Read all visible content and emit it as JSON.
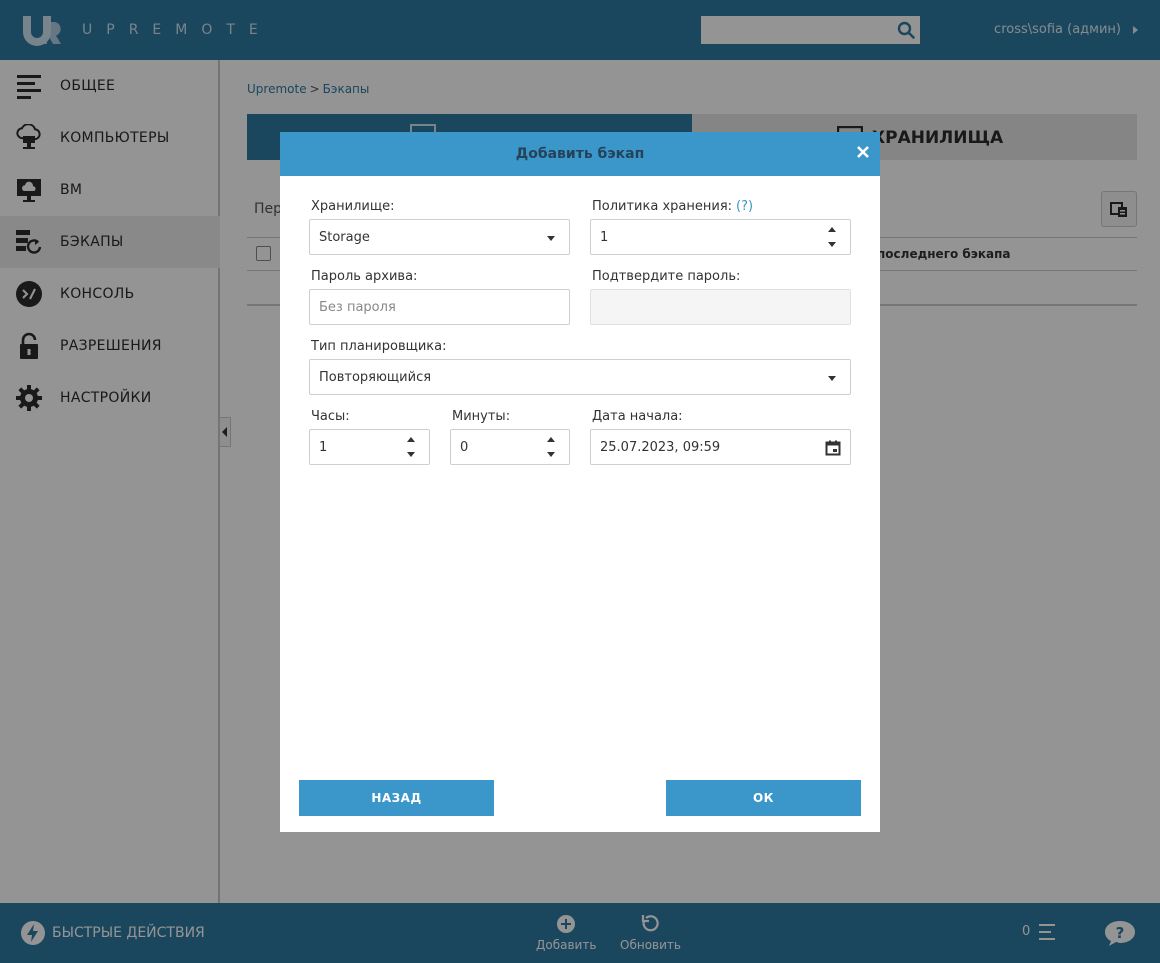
{
  "header": {
    "logo_text": "UPREMOTE",
    "search_value": "",
    "user": "cross\\sofia (админ)"
  },
  "sidebar": {
    "items": [
      {
        "label": "ОБЩЕЕ",
        "icon": "list-icon",
        "active": false
      },
      {
        "label": "КОМПЬЮТЕРЫ",
        "icon": "computers-icon",
        "active": false
      },
      {
        "label": "ВМ",
        "icon": "vm-icon",
        "active": false
      },
      {
        "label": "БЭКАПЫ",
        "icon": "backups-icon",
        "active": true
      },
      {
        "label": "КОНСОЛЬ",
        "icon": "console-icon",
        "active": false
      },
      {
        "label": "РАЗРЕШЕНИЯ",
        "icon": "lock-icon",
        "active": false
      },
      {
        "label": "НАСТРОЙКИ",
        "icon": "gear-icon",
        "active": false
      }
    ]
  },
  "main": {
    "breadcrumb": {
      "root": "Upremote",
      "separator": ">",
      "current": "Бэкапы"
    },
    "tabs": {
      "right_label": "ХРАНИЛИЩА"
    },
    "toolbar_text": "Пер",
    "table": {
      "last_column": "последнего бэкапа"
    }
  },
  "modal": {
    "title": "Добавить бэкап",
    "storage": {
      "label": "Хранилище:",
      "value": "Storage"
    },
    "retention": {
      "label": "Политика хранения:",
      "help": "(?)",
      "value": "1"
    },
    "password": {
      "label": "Пароль архива:",
      "placeholder": "Без пароля"
    },
    "confirm": {
      "label": "Подтвердите пароль:",
      "value": ""
    },
    "scheduler": {
      "label": "Тип планировщика:",
      "value": "Повторяющийся"
    },
    "hours": {
      "label": "Часы:",
      "value": "1"
    },
    "minutes": {
      "label": "Минуты:",
      "value": "0"
    },
    "start_date": {
      "label": "Дата начала:",
      "value": "25.07.2023, 09:59"
    },
    "back_label": "НАЗАД",
    "ok_label": "ОК"
  },
  "footer": {
    "quick_actions": "БЫСТРЫЕ ДЕЙСТВИЯ",
    "add_label": "Добавить",
    "refresh_label": "Обновить",
    "counter": "0"
  },
  "colors": {
    "brand": "#2f7aa3",
    "modal_header": "#3b97c9",
    "button": "#3b97c9"
  }
}
